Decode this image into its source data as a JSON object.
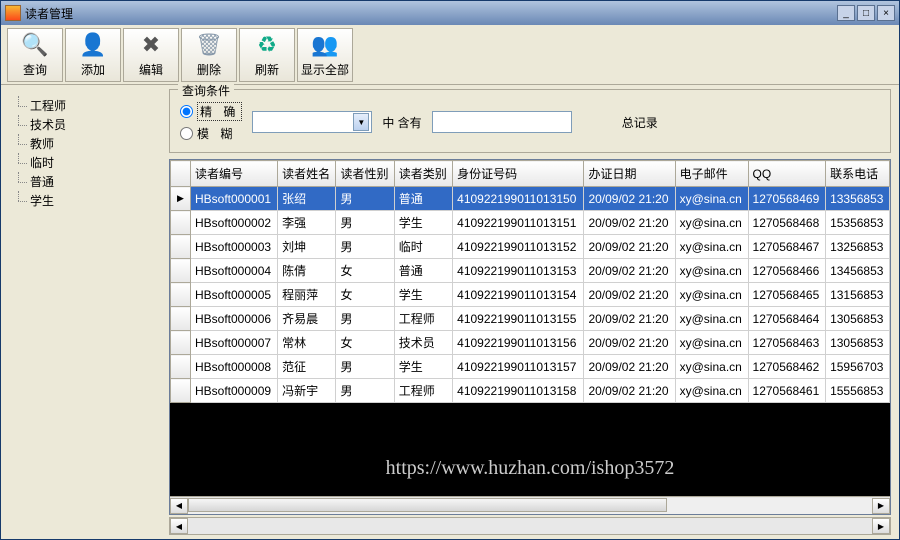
{
  "window": {
    "title": "读者管理"
  },
  "window_buttons": {
    "min": "_",
    "max": "□",
    "close": "×"
  },
  "toolbar": [
    {
      "key": "query",
      "label": "查询",
      "icon": "🔍",
      "color": "#c33"
    },
    {
      "key": "add",
      "label": "添加",
      "icon": "👤",
      "color": "#eb3"
    },
    {
      "key": "edit",
      "label": "编辑",
      "icon": "✖",
      "color": "#555"
    },
    {
      "key": "delete",
      "label": "删除",
      "icon": "🗑",
      "color": "#89a"
    },
    {
      "key": "refresh",
      "label": "刷新",
      "icon": "♻",
      "color": "#1a8"
    },
    {
      "key": "showall",
      "label": "显示全部",
      "icon": "👥",
      "color": "#e80"
    }
  ],
  "sidebar": {
    "items": [
      "工程师",
      "技术员",
      "教师",
      "临时",
      "普通",
      "学生"
    ]
  },
  "query": {
    "group_label": "查询条件",
    "radio_exact": "精 确",
    "radio_fuzzy": "模 糊",
    "radio_selected": "exact",
    "combo_value": "",
    "mid_label": "中 含有",
    "text_value": "",
    "total_label": "总记录"
  },
  "grid": {
    "columns": [
      "读者编号",
      "读者姓名",
      "读者性别",
      "读者类别",
      "身份证号码",
      "办证日期",
      "电子邮件",
      "QQ",
      "联系电话"
    ],
    "rows": [
      {
        "id": "HBsoft000001",
        "name": "张绍",
        "gender": "男",
        "type": "普通",
        "idcard": "410922199011013150",
        "date": "20/09/02 21:20",
        "email": "xy@sina.cn",
        "qq": "1270568469",
        "phone": "13356853"
      },
      {
        "id": "HBsoft000002",
        "name": "李强",
        "gender": "男",
        "type": "学生",
        "idcard": "410922199011013151",
        "date": "20/09/02 21:20",
        "email": "xy@sina.cn",
        "qq": "1270568468",
        "phone": "15356853"
      },
      {
        "id": "HBsoft000003",
        "name": "刘坤",
        "gender": "男",
        "type": "临时",
        "idcard": "410922199011013152",
        "date": "20/09/02 21:20",
        "email": "xy@sina.cn",
        "qq": "1270568467",
        "phone": "13256853"
      },
      {
        "id": "HBsoft000004",
        "name": "陈倩",
        "gender": "女",
        "type": "普通",
        "idcard": "410922199011013153",
        "date": "20/09/02 21:20",
        "email": "xy@sina.cn",
        "qq": "1270568466",
        "phone": "13456853"
      },
      {
        "id": "HBsoft000005",
        "name": "程丽萍",
        "gender": "女",
        "type": "学生",
        "idcard": "410922199011013154",
        "date": "20/09/02 21:20",
        "email": "xy@sina.cn",
        "qq": "1270568465",
        "phone": "13156853"
      },
      {
        "id": "HBsoft000006",
        "name": "齐易晨",
        "gender": "男",
        "type": "工程师",
        "idcard": "410922199011013155",
        "date": "20/09/02 21:20",
        "email": "xy@sina.cn",
        "qq": "1270568464",
        "phone": "13056853"
      },
      {
        "id": "HBsoft000007",
        "name": "常林",
        "gender": "女",
        "type": "技术员",
        "idcard": "410922199011013156",
        "date": "20/09/02 21:20",
        "email": "xy@sina.cn",
        "qq": "1270568463",
        "phone": "13056853"
      },
      {
        "id": "HBsoft000008",
        "name": "范征",
        "gender": "男",
        "type": "学生",
        "idcard": "410922199011013157",
        "date": "20/09/02 21:20",
        "email": "xy@sina.cn",
        "qq": "1270568462",
        "phone": "15956703"
      },
      {
        "id": "HBsoft000009",
        "name": "冯新宇",
        "gender": "男",
        "type": "工程师",
        "idcard": "410922199011013158",
        "date": "20/09/02 21:20",
        "email": "xy@sina.cn",
        "qq": "1270568461",
        "phone": "15556853"
      }
    ],
    "selected_index": 0
  },
  "watermark": "https://www.huzhan.com/ishop3572"
}
